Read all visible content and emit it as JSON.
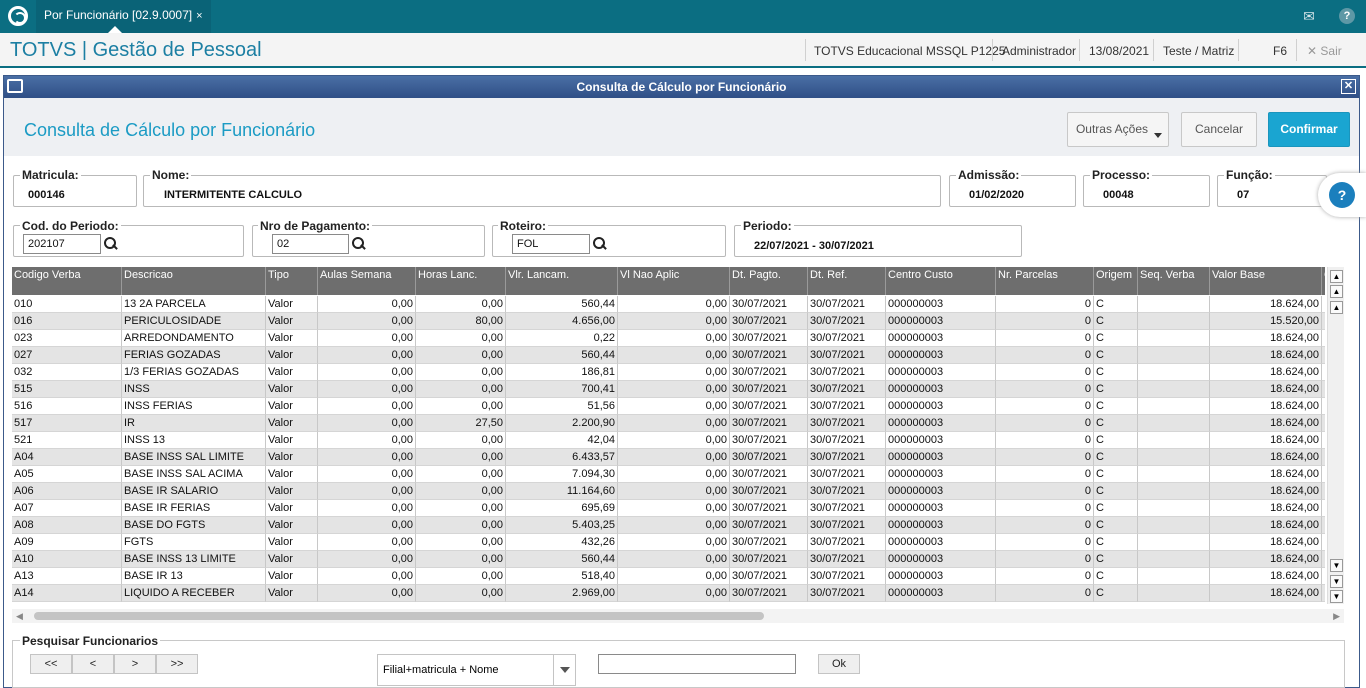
{
  "topbar": {
    "tab_label": "Por Funcionário [02.9.0007]",
    "tab_close": "×",
    "mail_icon": "envelope-icon",
    "help_icon": "question-icon"
  },
  "header": {
    "title": "TOTVS | Gestão de Pessoal",
    "environment": "TOTVS Educacional MSSQL P1225",
    "user": "Administrador",
    "date": "13/08/2021",
    "branch": "Teste / Matriz",
    "shortcut": "F6",
    "exit_label": "Sair"
  },
  "window": {
    "title": "Consulta de Cálculo por Funcionário",
    "page_title": "Consulta de Cálculo por Funcionário",
    "other_actions": "Outras Ações",
    "cancel": "Cancelar",
    "confirm": "Confirmar"
  },
  "fields": {
    "matricula_label": "Matricula:",
    "matricula": "000146",
    "nome_label": "Nome:",
    "nome": "INTERMITENTE CALCULO",
    "admissao_label": "Admissão:",
    "admissao": "01/02/2020",
    "processo_label": "Processo:",
    "processo": "00048",
    "funcao_label": "Função:",
    "funcao": "07",
    "periodo_cod_label": "Cod. do Periodo:",
    "periodo_cod": "202107",
    "nro_pag_label": "Nro de Pagamento:",
    "nro_pag": "02",
    "roteiro_label": "Roteiro:",
    "roteiro": "FOL",
    "periodo_label": "Periodo:",
    "periodo": "22/07/2021 - 30/07/2021"
  },
  "table": {
    "columns": [
      "Codigo Verba",
      "Descricao",
      "Tipo",
      "Aulas Semana",
      "Horas Lanc.",
      "Vlr. Lancam.",
      "Vl Nao Aplic",
      "Dt. Pagto.",
      "Dt. Ref.",
      "Centro Custo",
      "Nr. Parcelas",
      "Origem",
      "Seq. Verba",
      "Valor Base",
      "C"
    ],
    "rows": [
      [
        "010",
        "13 2A PARCELA",
        "Valor",
        "0,00",
        "0,00",
        "560,44",
        "0,00",
        "30/07/2021",
        "30/07/2021",
        "000000003",
        "0",
        "C",
        "",
        "18.624,00"
      ],
      [
        "016",
        "PERICULOSIDADE",
        "Valor",
        "0,00",
        "80,00",
        "4.656,00",
        "0,00",
        "30/07/2021",
        "30/07/2021",
        "000000003",
        "0",
        "C",
        "",
        "15.520,00"
      ],
      [
        "023",
        "ARREDONDAMENTO",
        "Valor",
        "0,00",
        "0,00",
        "0,22",
        "0,00",
        "30/07/2021",
        "30/07/2021",
        "000000003",
        "0",
        "C",
        "",
        "18.624,00"
      ],
      [
        "027",
        "FERIAS GOZADAS",
        "Valor",
        "0,00",
        "0,00",
        "560,44",
        "0,00",
        "30/07/2021",
        "30/07/2021",
        "000000003",
        "0",
        "C",
        "",
        "18.624,00"
      ],
      [
        "032",
        "1/3 FERIAS GOZADAS",
        "Valor",
        "0,00",
        "0,00",
        "186,81",
        "0,00",
        "30/07/2021",
        "30/07/2021",
        "000000003",
        "0",
        "C",
        "",
        "18.624,00"
      ],
      [
        "515",
        "INSS",
        "Valor",
        "0,00",
        "0,00",
        "700,41",
        "0,00",
        "30/07/2021",
        "30/07/2021",
        "000000003",
        "0",
        "C",
        "",
        "18.624,00"
      ],
      [
        "516",
        "INSS FERIAS",
        "Valor",
        "0,00",
        "0,00",
        "51,56",
        "0,00",
        "30/07/2021",
        "30/07/2021",
        "000000003",
        "0",
        "C",
        "",
        "18.624,00"
      ],
      [
        "517",
        "IR",
        "Valor",
        "0,00",
        "27,50",
        "2.200,90",
        "0,00",
        "30/07/2021",
        "30/07/2021",
        "000000003",
        "0",
        "C",
        "",
        "18.624,00"
      ],
      [
        "521",
        "INSS 13",
        "Valor",
        "0,00",
        "0,00",
        "42,04",
        "0,00",
        "30/07/2021",
        "30/07/2021",
        "000000003",
        "0",
        "C",
        "",
        "18.624,00"
      ],
      [
        "A04",
        "BASE INSS SAL LIMITE",
        "Valor",
        "0,00",
        "0,00",
        "6.433,57",
        "0,00",
        "30/07/2021",
        "30/07/2021",
        "000000003",
        "0",
        "C",
        "",
        "18.624,00"
      ],
      [
        "A05",
        "BASE INSS SAL ACIMA",
        "Valor",
        "0,00",
        "0,00",
        "7.094,30",
        "0,00",
        "30/07/2021",
        "30/07/2021",
        "000000003",
        "0",
        "C",
        "",
        "18.624,00"
      ],
      [
        "A06",
        "BASE IR SALARIO",
        "Valor",
        "0,00",
        "0,00",
        "11.164,60",
        "0,00",
        "30/07/2021",
        "30/07/2021",
        "000000003",
        "0",
        "C",
        "",
        "18.624,00"
      ],
      [
        "A07",
        "BASE IR FERIAS",
        "Valor",
        "0,00",
        "0,00",
        "695,69",
        "0,00",
        "30/07/2021",
        "30/07/2021",
        "000000003",
        "0",
        "C",
        "",
        "18.624,00"
      ],
      [
        "A08",
        "BASE DO FGTS",
        "Valor",
        "0,00",
        "0,00",
        "5.403,25",
        "0,00",
        "30/07/2021",
        "30/07/2021",
        "000000003",
        "0",
        "C",
        "",
        "18.624,00"
      ],
      [
        "A09",
        "FGTS",
        "Valor",
        "0,00",
        "0,00",
        "432,26",
        "0,00",
        "30/07/2021",
        "30/07/2021",
        "000000003",
        "0",
        "C",
        "",
        "18.624,00"
      ],
      [
        "A10",
        "BASE INSS 13 LIMITE",
        "Valor",
        "0,00",
        "0,00",
        "560,44",
        "0,00",
        "30/07/2021",
        "30/07/2021",
        "000000003",
        "0",
        "C",
        "",
        "18.624,00"
      ],
      [
        "A13",
        "BASE IR 13",
        "Valor",
        "0,00",
        "0,00",
        "518,40",
        "0,00",
        "30/07/2021",
        "30/07/2021",
        "000000003",
        "0",
        "C",
        "",
        "18.624,00"
      ],
      [
        "A14",
        "LIQUIDO A RECEBER",
        "Valor",
        "0,00",
        "0,00",
        "2.969,00",
        "0,00",
        "30/07/2021",
        "30/07/2021",
        "000000003",
        "0",
        "C",
        "",
        "18.624,00"
      ]
    ]
  },
  "search": {
    "legend": "Pesquisar Funcionarios",
    "first": "<<",
    "prev": "<",
    "next": ">",
    "last": ">>",
    "order": "Filial+matricula + Nome",
    "ok": "Ok",
    "query": ""
  },
  "colors": {
    "topbar": "#0b6e82",
    "accent": "#1aa5d1",
    "grid_header": "#6e6e6e"
  }
}
